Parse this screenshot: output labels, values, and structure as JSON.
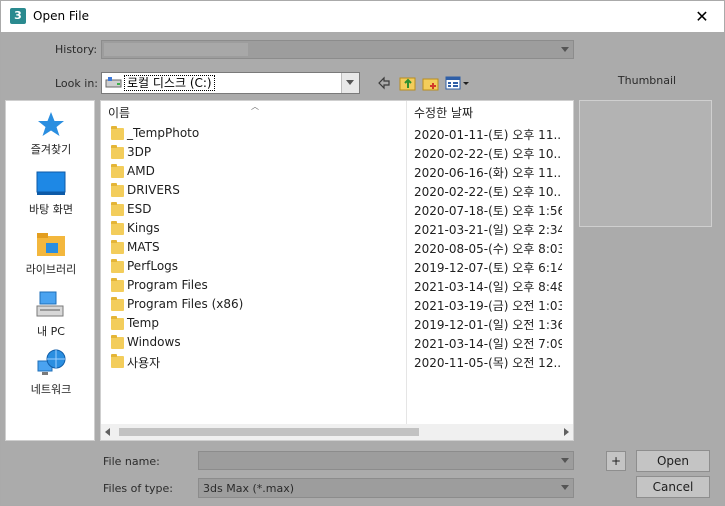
{
  "window": {
    "title": "Open File",
    "app_icon": "3",
    "close_glyph": "✕"
  },
  "history": {
    "label": "History:",
    "value": ""
  },
  "look_in": {
    "label": "Look in:",
    "value": "로컬 디스크 (C:)"
  },
  "toolbar": {
    "icons": [
      "back-arrow-icon",
      "up-folder-icon",
      "new-folder-icon",
      "view-menu-icon"
    ]
  },
  "places": [
    {
      "label": "즐겨찾기",
      "icon": "star-icon"
    },
    {
      "label": "바탕 화면",
      "icon": "desktop-icon"
    },
    {
      "label": "라이브러리",
      "icon": "library-icon"
    },
    {
      "label": "내 PC",
      "icon": "computer-icon"
    },
    {
      "label": "네트워크",
      "icon": "network-icon"
    }
  ],
  "columns": {
    "name": "이름",
    "date": "수정한 날짜"
  },
  "files": [
    {
      "name": "_TempPhoto",
      "date": "2020-01-11-(토) 오후 11..."
    },
    {
      "name": "3DP",
      "date": "2020-02-22-(토) 오후 10..."
    },
    {
      "name": "AMD",
      "date": "2020-06-16-(화) 오후 11..."
    },
    {
      "name": "DRIVERS",
      "date": "2020-02-22-(토) 오후 10..."
    },
    {
      "name": "ESD",
      "date": "2020-07-18-(토) 오후 1:56"
    },
    {
      "name": "Kings",
      "date": "2021-03-21-(일) 오후 2:34"
    },
    {
      "name": "MATS",
      "date": "2020-08-05-(수) 오후 8:03"
    },
    {
      "name": "PerfLogs",
      "date": "2019-12-07-(토) 오후 6:14"
    },
    {
      "name": "Program Files",
      "date": "2021-03-14-(일) 오후 8:48"
    },
    {
      "name": "Program Files (x86)",
      "date": "2021-03-19-(금) 오전 1:03"
    },
    {
      "name": "Temp",
      "date": "2019-12-01-(일) 오전 1:36"
    },
    {
      "name": "Windows",
      "date": "2021-03-14-(일) 오전 7:09"
    },
    {
      "name": "사용자",
      "date": "2020-11-05-(목) 오전 12..."
    }
  ],
  "thumbnail": {
    "label": "Thumbnail"
  },
  "file_name": {
    "label": "File name:",
    "value": ""
  },
  "file_type": {
    "label": "Files of type:",
    "value": "3ds Max (*.max)"
  },
  "buttons": {
    "plus": "+",
    "open": "Open",
    "cancel": "Cancel"
  }
}
